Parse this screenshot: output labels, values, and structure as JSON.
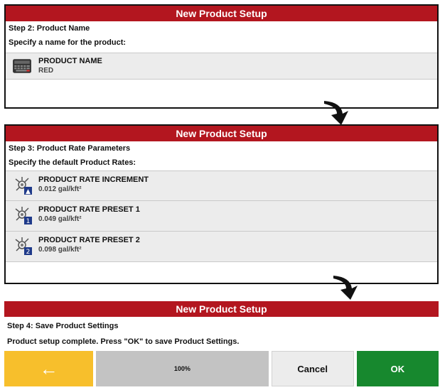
{
  "panel1": {
    "title": "New Product Setup",
    "step": "Step 2: Product Name",
    "prompt": "Specify a name for the product:",
    "field": {
      "label": "PRODUCT NAME",
      "value": "RED",
      "icon": "keyboard-icon"
    }
  },
  "panel2": {
    "title": "New Product Setup",
    "step": "Step 3: Product Rate Parameters",
    "prompt": "Specify the default Product Rates:",
    "rows": [
      {
        "label": "PRODUCT RATE INCREMENT",
        "value": "0.012 gal/kft²",
        "icon": "rate-increment-icon",
        "badge": "▲"
      },
      {
        "label": "PRODUCT RATE PRESET 1",
        "value": "0.049 gal/kft²",
        "icon": "rate-preset-1-icon",
        "badge": "1"
      },
      {
        "label": "PRODUCT RATE PRESET 2",
        "value": "0.098 gal/kft²",
        "icon": "rate-preset-2-icon",
        "badge": "2"
      }
    ]
  },
  "panel3": {
    "title": "New Product Setup",
    "step": "Step 4: Save Product Settings",
    "prompt": "Product setup complete. Press \"OK\" to save Product Settings."
  },
  "footer": {
    "back": "←",
    "progress": "100%",
    "cancel": "Cancel",
    "ok": "OK"
  },
  "colors": {
    "title_bar": "#b3161f",
    "back_button": "#f7bf2c",
    "ok_button": "#17882e",
    "progress_button": "#c3c3c3",
    "badge": "#1f3a8a"
  }
}
